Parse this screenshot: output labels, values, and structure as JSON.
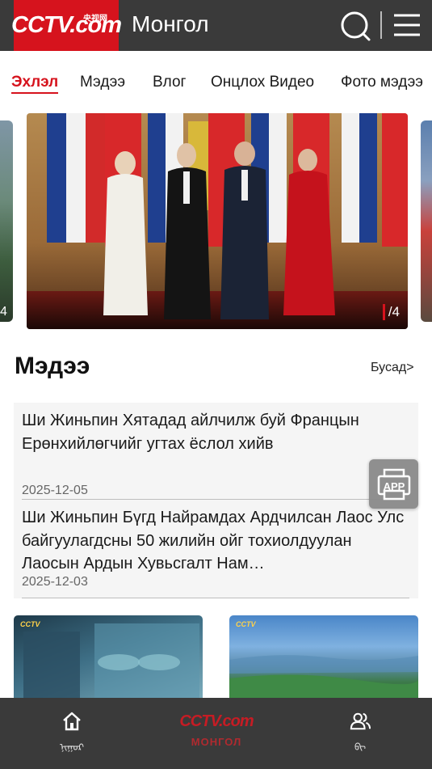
{
  "header": {
    "logo_text": "CCTV.com",
    "logo_cn": "央视网",
    "title": "Монгол"
  },
  "tabs": [
    {
      "label": "Эхлэл",
      "active": true
    },
    {
      "label": "Мэдээ",
      "active": false
    },
    {
      "label": "Влог",
      "active": false
    },
    {
      "label": "Онцлох Видео",
      "active": false
    },
    {
      "label": "Фото мэдээ",
      "active": false
    }
  ],
  "carousel": {
    "counter_total": "/4",
    "left_peek_number": "4"
  },
  "news_section": {
    "title": "Мэдээ",
    "more": "Бусад>",
    "items": [
      {
        "title": "Ши Жиньпин Хятадад айлчилж буй Францын Ерөнхийлөгчийг угтах ёслол хийв",
        "date": "2025-12-05"
      },
      {
        "title": "Ши Жиньпин Бүгд Найрамдах Ардчилсан Лаос Улс байгуулагдсны 50 жилийн ойг тохиолдуулан Лаосын Ардын Хувьсгалт Нам…",
        "date": "2025-12-03"
      }
    ]
  },
  "app_button": {
    "label": "APP"
  },
  "thumbs": [
    {
      "logo": "CCTV"
    },
    {
      "logo": "CCTV"
    }
  ],
  "bottom_nav": {
    "home_label": "ᠨᠢᠭᠤᠷ",
    "center_logo": "CCTV.com",
    "center_label": "МОНГОЛ",
    "me_label": "ᠪᠢ"
  },
  "colors": {
    "brand_red": "#d6131d",
    "header_bg": "#3a3a3a",
    "card_bg": "#f5f5f5"
  },
  "icons": [
    "search-icon",
    "menu-icon",
    "home-icon",
    "user-icon",
    "app-icon"
  ]
}
